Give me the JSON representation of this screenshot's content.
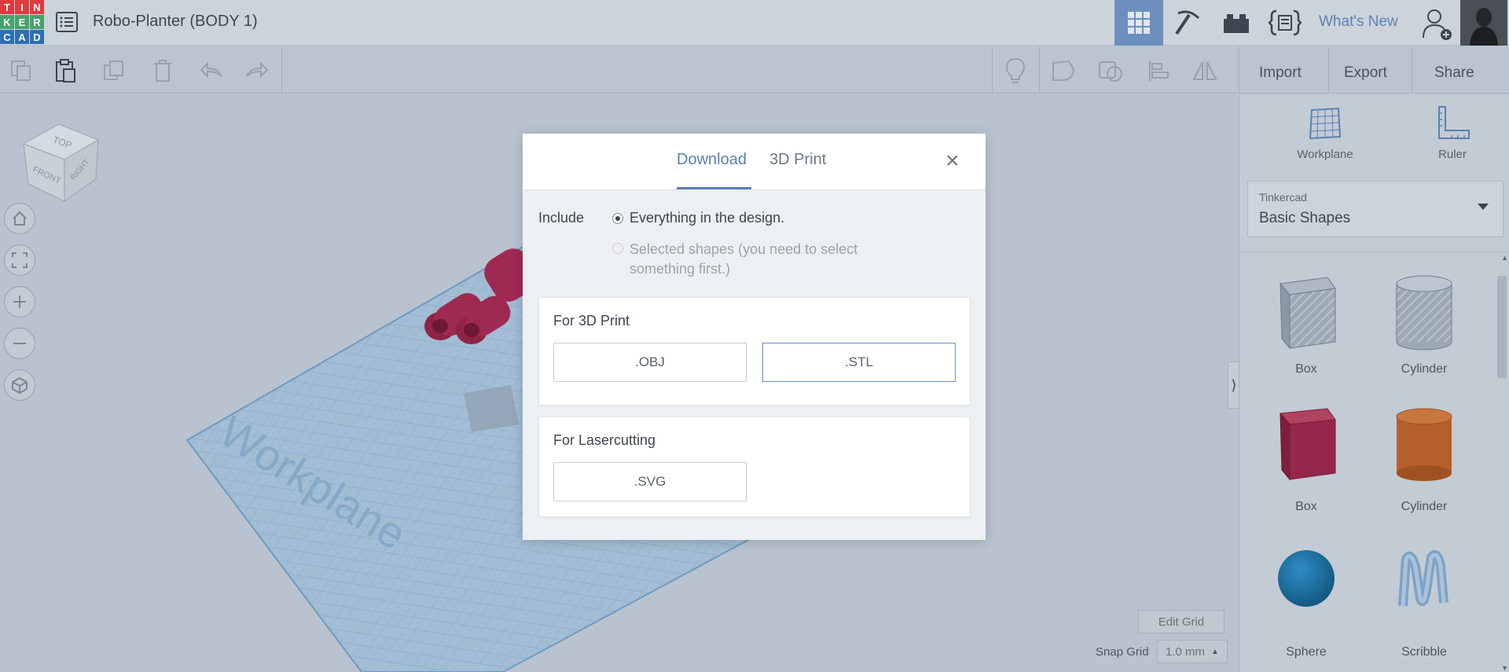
{
  "app": {
    "logo_letters": [
      "T",
      "I",
      "N",
      "K",
      "E",
      "R",
      "C",
      "A",
      "D"
    ],
    "logo_colors": [
      "#e2383f",
      "#e2383f",
      "#e2383f",
      "#46a36b",
      "#46a36b",
      "#46a36b",
      "#2d6fb5",
      "#2d6fb5",
      "#2d6fb5"
    ],
    "document_title": "Robo-Planter (BODY 1)"
  },
  "topbar": {
    "whats_new": "What's New",
    "active_view_color": "#6c8fc0"
  },
  "toolbar": {
    "import": "Import",
    "export": "Export",
    "share": "Share"
  },
  "viewport": {
    "workplane_label": "Workplane",
    "view_cube": {
      "top": "TOP",
      "front": "FRONT",
      "right": "RIGHT"
    },
    "edit_grid": "Edit Grid",
    "snap_grid_label": "Snap Grid",
    "snap_grid_value": "1.0 mm"
  },
  "right_panel": {
    "workplane": "Workplane",
    "ruler": "Ruler",
    "library_category": "Tinkercad",
    "library_name": "Basic Shapes",
    "shapes": [
      {
        "label": "Box",
        "icon": "box-hole-icon"
      },
      {
        "label": "Cylinder",
        "icon": "cylinder-hole-icon"
      },
      {
        "label": "Box",
        "icon": "box-solid-icon"
      },
      {
        "label": "Cylinder",
        "icon": "cylinder-solid-icon"
      },
      {
        "label": "Sphere",
        "icon": "sphere-icon"
      },
      {
        "label": "Scribble",
        "icon": "scribble-icon"
      }
    ]
  },
  "modal": {
    "tabs": {
      "download": "Download",
      "print": "3D Print"
    },
    "close": "×",
    "include_label": "Include",
    "option_everything": "Everything in the design.",
    "option_selected": "Selected shapes (you need to select something first.)",
    "section_3d": "For 3D Print",
    "btn_obj": ".OBJ",
    "btn_stl": ".STL",
    "section_laser": "For Lasercutting",
    "btn_svg": ".SVG"
  }
}
